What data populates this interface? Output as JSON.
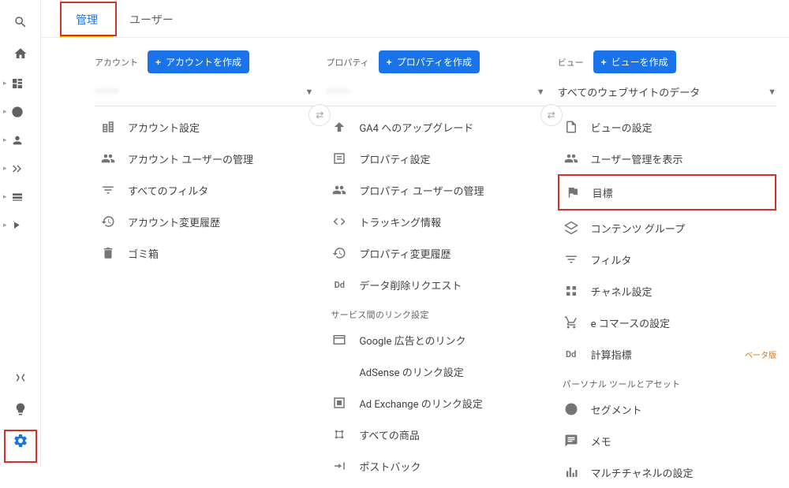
{
  "tabs": {
    "admin": "管理",
    "user": "ユーザー"
  },
  "sidebar": {},
  "columns": {
    "account": {
      "title": "アカウント",
      "createLabel": "アカウントを作成",
      "selected": "———",
      "items": [
        {
          "icon": "building",
          "label": "アカウント設定"
        },
        {
          "icon": "people",
          "label": "アカウント ユーザーの管理"
        },
        {
          "icon": "filter",
          "label": "すべてのフィルタ"
        },
        {
          "icon": "history",
          "label": "アカウント変更履歴"
        },
        {
          "icon": "trash",
          "label": "ゴミ箱"
        }
      ]
    },
    "property": {
      "title": "プロパティ",
      "createLabel": "プロパティを作成",
      "selected": "———",
      "sectionLink": "サービス間のリンク設定",
      "items1": [
        {
          "icon": "upgrade",
          "label": "GA4 へのアップグレード"
        },
        {
          "icon": "settings-box",
          "label": "プロパティ設定"
        },
        {
          "icon": "people",
          "label": "プロパティ ユーザーの管理"
        },
        {
          "icon": "code",
          "label": "トラッキング情報"
        },
        {
          "icon": "history",
          "label": "プロパティ変更履歴"
        },
        {
          "icon": "dd",
          "label": "データ削除リクエスト"
        }
      ],
      "items2": [
        {
          "icon": "ads",
          "label": "Google 広告とのリンク"
        },
        {
          "icon": "",
          "label": "AdSense のリンク設定"
        },
        {
          "icon": "adx",
          "label": "Ad Exchange のリンク設定"
        },
        {
          "icon": "products",
          "label": "すべての商品"
        },
        {
          "icon": "postback",
          "label": "ポストバック"
        }
      ]
    },
    "view": {
      "title": "ビュー",
      "createLabel": "ビューを作成",
      "selected": "すべてのウェブサイトのデータ",
      "sectionPersonal": "パーソナル ツールとアセット",
      "items1": [
        {
          "icon": "doc",
          "label": "ビューの設定"
        },
        {
          "icon": "people",
          "label": "ユーザー管理を表示"
        }
      ],
      "goal": {
        "icon": "flag",
        "label": "目標"
      },
      "items2": [
        {
          "icon": "content-group",
          "label": "コンテンツ グループ"
        },
        {
          "icon": "filter",
          "label": "フィルタ"
        },
        {
          "icon": "channel",
          "label": "チャネル設定"
        },
        {
          "icon": "cart",
          "label": "e コマースの設定"
        },
        {
          "icon": "dd",
          "label": "計算指標",
          "badge": "ベータ版"
        }
      ],
      "items3": [
        {
          "icon": "segment",
          "label": "セグメント"
        },
        {
          "icon": "memo",
          "label": "メモ"
        },
        {
          "icon": "multichannel",
          "label": "マルチチャネルの設定"
        }
      ]
    }
  }
}
